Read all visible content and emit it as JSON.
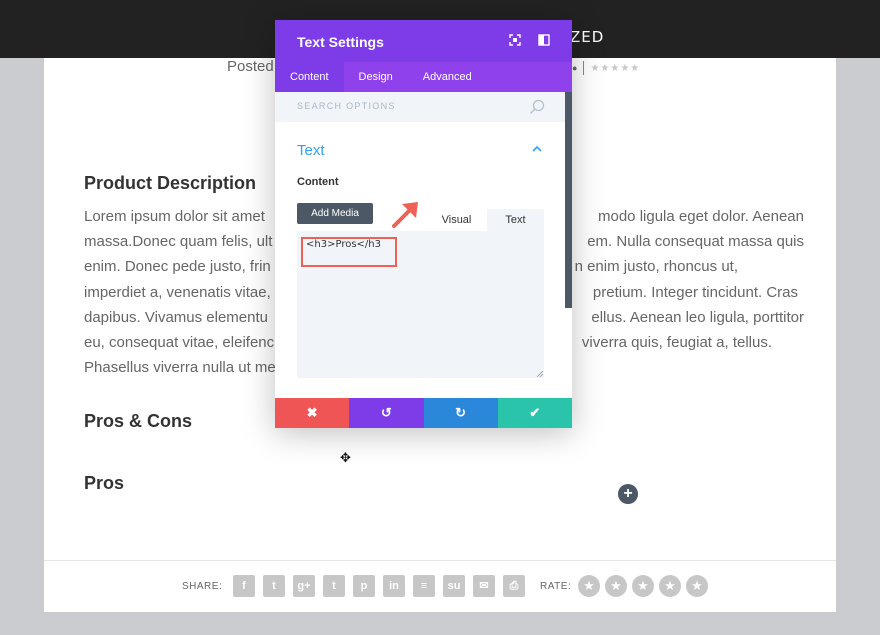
{
  "topbar": {
    "title_fragment": "ZED"
  },
  "post": {
    "posted_prefix": "Posted",
    "heading_description": "Product Description",
    "paragraph_lines": [
      "Lorem ipsum dolor sit amet",
      "massa.Donec quam felis, ult",
      "enim. Donec pede justo, frin",
      "imperdiet a, venenatis vitae,",
      "dapibus. Vivamus elementu",
      "eu, consequat vitae, eleifenc",
      "Phasellus viverra nulla ut me"
    ],
    "paragraph_lines_right": [
      "modo ligula eget dolor. Aenean",
      "em. Nulla consequat massa quis",
      "n enim justo, rhoncus ut,",
      "pretium. Integer tincidunt. Cras",
      "ellus. Aenean leo ligula, porttitor",
      "viverra quis, feugiat a, tellus.",
      ""
    ],
    "heading_proscons": "Pros & Cons",
    "heading_pros": "Pros"
  },
  "share": {
    "label": "SHARE:",
    "icons": [
      {
        "name": "facebook-icon",
        "glyph": "f"
      },
      {
        "name": "twitter-icon",
        "glyph": "t"
      },
      {
        "name": "google-plus-icon",
        "glyph": "g+"
      },
      {
        "name": "tumblr-icon",
        "glyph": "t"
      },
      {
        "name": "pinterest-icon",
        "glyph": "p"
      },
      {
        "name": "linkedin-icon",
        "glyph": "in"
      },
      {
        "name": "buffer-icon",
        "glyph": "≡"
      },
      {
        "name": "stumbleupon-icon",
        "glyph": "su"
      },
      {
        "name": "email-icon",
        "glyph": "✉"
      },
      {
        "name": "print-icon",
        "glyph": "⎙"
      }
    ],
    "rate_label": "RATE:",
    "rate_star_glyph": "★"
  },
  "modal": {
    "title": "Text Settings",
    "tabs": [
      "Content",
      "Design",
      "Advanced"
    ],
    "search_placeholder": "SEARCH OPTIONS",
    "section_title": "Text",
    "content_label": "Content",
    "add_media_label": "Add Media",
    "editor_tab_visual": "Visual",
    "editor_tab_text": "Text",
    "editor_value": "<h3>Pros</h3",
    "footer": {
      "cancel_glyph": "✖",
      "undo_glyph": "↺",
      "redo_glyph": "↻",
      "save_glyph": "✔"
    }
  },
  "colors": {
    "purple_header": "#7e3be8",
    "purple_tabs": "#8f42ec",
    "cancel_red": "#ef5555",
    "undo_purple": "#7e3be8",
    "redo_blue": "#2b87da",
    "save_teal": "#29c4a9",
    "accent_blue": "#2ea3f2",
    "annotation_red": "#ef6154"
  }
}
